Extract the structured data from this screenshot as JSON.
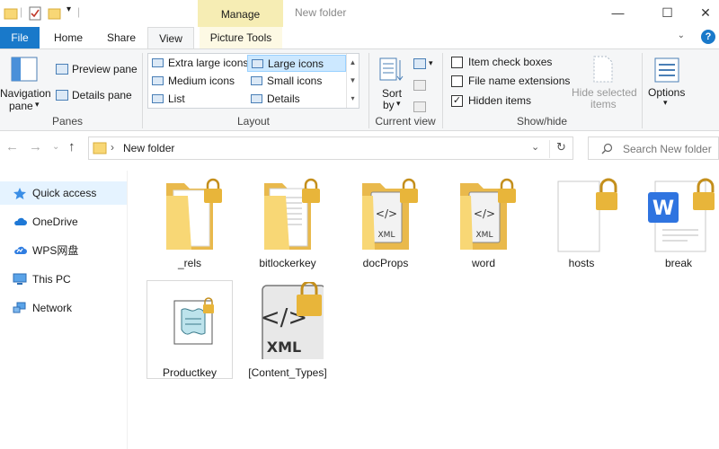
{
  "window": {
    "title": "New folder",
    "context_tab": "Manage",
    "minimize": "—",
    "maximize": "☐",
    "close": "✕"
  },
  "tabs": {
    "file": "File",
    "home": "Home",
    "share": "Share",
    "view": "View",
    "picture_tools": "Picture Tools"
  },
  "ribbon": {
    "panes": {
      "navigation_pane_line1": "Navigation",
      "navigation_pane_line2": "pane",
      "preview_pane": "Preview pane",
      "details_pane": "Details pane",
      "group_label": "Panes"
    },
    "layout": {
      "extra_large_icons": "Extra large icons",
      "large_icons": "Large icons",
      "medium_icons": "Medium icons",
      "small_icons": "Small icons",
      "list": "List",
      "details": "Details",
      "group_label": "Layout",
      "selected": "large_icons"
    },
    "current_view": {
      "sort_line1": "Sort",
      "sort_line2": "by",
      "group_label": "Current view"
    },
    "show_hide": {
      "item_check_boxes": "Item check boxes",
      "file_name_extensions": "File name extensions",
      "hidden_items": "Hidden items",
      "item_check_boxes_checked": false,
      "file_name_extensions_checked": false,
      "hidden_items_checked": true,
      "check_mark": "✓",
      "hide_selected_line1": "Hide selected",
      "hide_selected_line2": "items",
      "group_label": "Show/hide"
    },
    "options": {
      "label": "Options"
    }
  },
  "address_bar": {
    "path": "New folder",
    "search_placeholder": "Search New folder"
  },
  "nav_pane": {
    "items": [
      {
        "label": "Quick access",
        "icon": "star-icon"
      },
      {
        "label": "OneDrive",
        "icon": "cloud-icon"
      },
      {
        "label": "WPS网盘",
        "icon": "wps-cloud-icon"
      },
      {
        "label": "This PC",
        "icon": "computer-icon"
      },
      {
        "label": "Network",
        "icon": "network-icon"
      }
    ],
    "selected": "Quick access"
  },
  "files": [
    {
      "name": "_rels",
      "type": "folder",
      "locked": true
    },
    {
      "name": "bitlockerkey",
      "type": "folder",
      "locked": true
    },
    {
      "name": "docProps",
      "type": "folder",
      "locked": true
    },
    {
      "name": "word",
      "type": "folder",
      "locked": true
    },
    {
      "name": "hosts",
      "type": "file",
      "locked": true
    },
    {
      "name": "break",
      "type": "wps-document",
      "locked": true
    },
    {
      "name": "Productkey",
      "type": "script",
      "locked": true
    },
    {
      "name": "[Content_Types]",
      "type": "xml",
      "locked": true
    }
  ],
  "xml_text": "XML",
  "xml_tag": "</>",
  "wps_letter": "W",
  "colors": {
    "accent": "#1979ca",
    "manage_tab": "#f6edb4",
    "folder": "#f8d775",
    "lock": "#e8b53a",
    "selection": "#cce8ff"
  }
}
